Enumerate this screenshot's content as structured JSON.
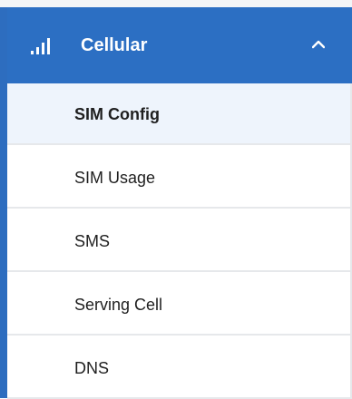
{
  "menu": {
    "header": {
      "label": "Cellular",
      "icon": "signal-bars-icon",
      "toggle_icon": "chevron-up-icon",
      "expanded": true
    },
    "items": [
      {
        "label": "SIM Config",
        "active": true
      },
      {
        "label": "SIM Usage",
        "active": false
      },
      {
        "label": "SMS",
        "active": false
      },
      {
        "label": "Serving Cell",
        "active": false
      },
      {
        "label": "DNS",
        "active": false
      }
    ]
  },
  "colors": {
    "header_background": "#2c6fc3",
    "header_text": "#ffffff",
    "active_item_background": "#eef4fc",
    "item_text": "#1f1f1f",
    "divider": "#e6e8eb"
  }
}
